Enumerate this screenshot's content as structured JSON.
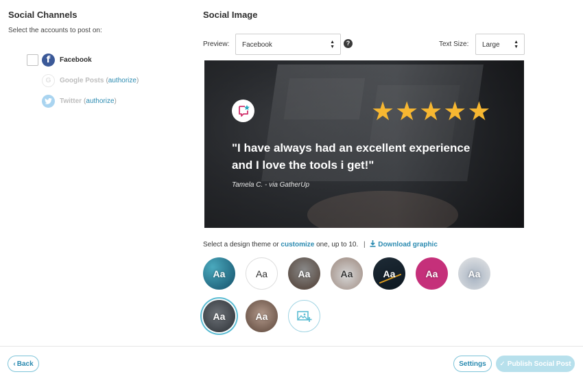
{
  "channels": {
    "title": "Social Channels",
    "subtitle": "Select the accounts to post on:",
    "items": [
      {
        "icon": "facebook-icon",
        "name": "Facebook",
        "authorize": ""
      },
      {
        "icon": "google-icon",
        "name": "Google Posts",
        "authorize": "authorize"
      },
      {
        "icon": "twitter-icon",
        "name": "Twitter",
        "authorize": "authorize"
      }
    ]
  },
  "social_image": {
    "title": "Social Image",
    "preview_label": "Preview:",
    "preview_value": "Facebook",
    "text_size_label": "Text Size:",
    "text_size_value": "Large",
    "help_glyph": "?"
  },
  "review": {
    "stars": 5,
    "star_color": "#f7b731",
    "quote": "\"I have always had an excellent experience and I love the tools i get!\"",
    "attribution": "Tamela C. - via GatherUp"
  },
  "theme_line": {
    "prefix": "Select a design theme or",
    "customize": "customize",
    "suffix": "one, up to 10.",
    "separator": "|",
    "download": "Download graphic"
  },
  "themes": {
    "label": "Aa",
    "selected_index": 7
  },
  "footer": {
    "back": "Back",
    "settings": "Settings",
    "publish": "Publish Social Post"
  },
  "colors": {
    "accent": "#2a8ab0",
    "facebook": "#3b5998",
    "publish_disabled": "#b7e0ec"
  }
}
